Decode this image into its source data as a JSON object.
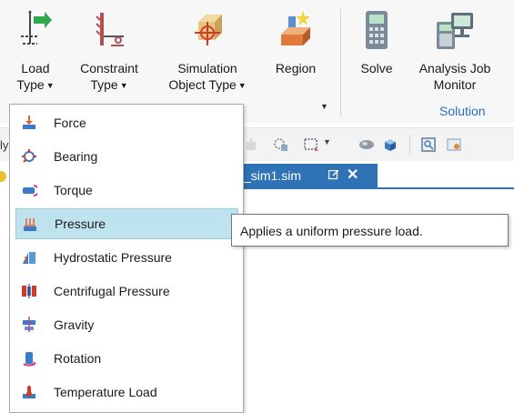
{
  "ribbon": {
    "buttons": [
      {
        "label1": "Load",
        "label2": "Type",
        "icon": "load-type-icon"
      },
      {
        "label1": "Constraint",
        "label2": "Type",
        "icon": "constraint-type-icon"
      },
      {
        "label1": "Simulation",
        "label2": "Object Type",
        "icon": "simulation-object-icon"
      },
      {
        "label1": "Region",
        "label2": "",
        "icon": "region-icon"
      },
      {
        "label1": "Solve",
        "label2": "",
        "icon": "solve-icon"
      },
      {
        "label1": "Analysis Job",
        "label2": "Monitor",
        "icon": "analysis-job-monitor-icon"
      }
    ],
    "solution_group_label": "Solution"
  },
  "edge_text": "ly",
  "document_tab": {
    "name": "_sim1.sim",
    "close": "✕"
  },
  "menu": {
    "items": [
      {
        "label": "Force",
        "icon": "force-icon"
      },
      {
        "label": "Bearing",
        "icon": "bearing-icon"
      },
      {
        "label": "Torque",
        "icon": "torque-icon"
      },
      {
        "label": "Pressure",
        "icon": "pressure-icon",
        "highlighted": true
      },
      {
        "label": "Hydrostatic Pressure",
        "icon": "hydrostatic-pressure-icon"
      },
      {
        "label": "Centrifugal Pressure",
        "icon": "centrifugal-pressure-icon"
      },
      {
        "label": "Gravity",
        "icon": "gravity-icon"
      },
      {
        "label": "Rotation",
        "icon": "rotation-icon"
      },
      {
        "label": "Temperature Load",
        "icon": "temperature-load-icon"
      }
    ]
  },
  "tooltip": {
    "text": "Applies a uniform pressure load."
  },
  "colors": {
    "accent": "#2f72b5",
    "highlight": "#bfe3ee",
    "group_label": "#2a6ebb"
  }
}
